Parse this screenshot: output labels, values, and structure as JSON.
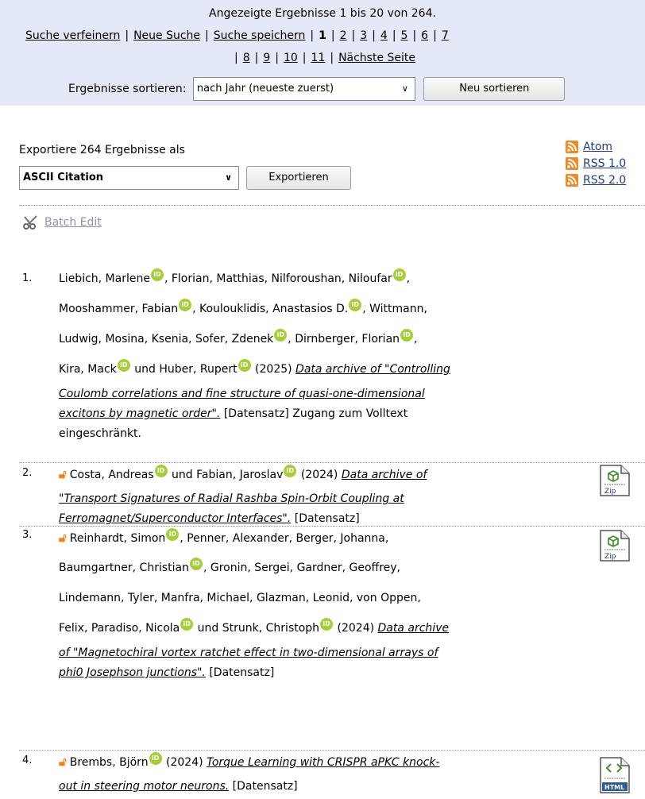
{
  "header": {
    "summary": "Angezeigte Ergebnisse 1 bis 20 von 264.",
    "refine": "Suche verfeinern",
    "new_search": "Neue Suche",
    "save_search": "Suche speichern",
    "pages": [
      "1",
      "2",
      "3",
      "4",
      "5",
      "6",
      "7",
      "8",
      "9",
      "10",
      "11"
    ],
    "next": "Nächste Seite",
    "sort_label": "Ergebnisse sortieren:",
    "sort_value": "nach Jahr (neueste zuerst)",
    "resort_button": "Neu sortieren"
  },
  "export": {
    "label": "Exportiere 264 Ergebnisse als",
    "format": "ASCII Citation",
    "button": "Exportieren"
  },
  "feeds": [
    "Atom",
    "RSS 1.0",
    "RSS 2.0"
  ],
  "batch_edit": "Batch Edit",
  "results": [
    {
      "num": "1.",
      "authors_l1a": "Liebich, Marlene",
      "authors_l1b": ", Florian, Matthias, Nilforoushan, Niloufar",
      "authors_l1c": ",",
      "authors_l2a": "Mooshammer, Fabian",
      "authors_l2b": ", Koulouklidis, Anastasios D.",
      "authors_l2c": ", Wittmann,",
      "authors_l3a": "Ludwig, Mosina, Ksenia, Sofer, Zdenek",
      "authors_l3b": ", Dirnberger, Florian",
      "authors_l3c": ",",
      "authors_l4a": "Kira, Mack",
      "authors_l4b": " und Huber, Rupert",
      "authors_l4c": " (2025) ",
      "title_l1": "Data archive of \"Controlling",
      "title_l2": "Coulomb correlations and fine structure of quasi-one-dimensional",
      "title_l3": "excitons by magnetic order\".",
      "suffix_l3": " [Datensatz] Zugang zum Volltext",
      "suffix_l4": "eingeschränkt."
    },
    {
      "num": "2.",
      "authors_a": "Costa, Andreas",
      "authors_b": " und Fabian, Jaroslav",
      "authors_c": " (2024) ",
      "title_l1": "Data archive of",
      "title_l2": "\"Transport Signatures of Radial Rashba Spin-Orbit Coupling at",
      "title_l3": "Ferromagnet/Superconductor Interfaces\".",
      "suffix": " [Datensatz]",
      "file_type": "Zip"
    },
    {
      "num": "3.",
      "l1a": "Reinhardt, Simon",
      "l1b": ", Penner, Alexander, Berger, Johanna,",
      "l2a": "Baumgartner, Christian",
      "l2b": ", Gronin, Sergei, Gardner, Geoffrey,",
      "l3": "Lindemann, Tyler, Manfra, Michael, Glazman, Leonid, von Oppen,",
      "l4a": "Felix, Paradiso, Nicola",
      "l4b": " und Strunk, Christoph",
      "l4c": " (2024) ",
      "title_l1": "Data archive",
      "title_l2": "of \"Magnetochiral vortex ratchet effect in two-dimensional arrays of",
      "title_l3": "phi0 Josephson junctions\".",
      "suffix": " [Datensatz]",
      "file_type": "Zip"
    },
    {
      "num": "4.",
      "authors_a": "Brembs, Björn",
      "authors_c": " (2024) ",
      "title_l1": "Torque Learning with CRISPR aPKC knock-",
      "title_l2": "out in steering motor neurons.",
      "suffix": " [Datensatz]",
      "file_type": "HTML"
    }
  ],
  "colors": {
    "topbar_bg": "#e4e9f7",
    "orcid": "#a6ce39",
    "open_access": "#f68212",
    "feed": "#f08a24"
  }
}
